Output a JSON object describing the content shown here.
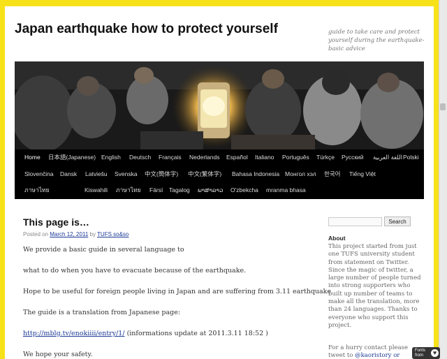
{
  "site": {
    "title": "Japan earthquake how to protect yourself",
    "tagline": "guide to take care and protect yourself during the earthquake- basic advice"
  },
  "nav": {
    "rows": [
      [
        "Home",
        "日本語(Japanese)",
        "English",
        "Deutsch",
        "Français",
        "Nederlands",
        "Español",
        "Italiano",
        "Português",
        "Türkçe",
        "Русский",
        "اللغة العربية",
        "Polski"
      ],
      [
        "Slovenčina",
        "Dansk",
        "Latviešu",
        "Svenska",
        "中文(簡体字)",
        "中文(繁体字)",
        "Bahasa Indonesia",
        "Монгол хэл",
        "한국어",
        "Tiếng Việt"
      ],
      [
        "ภาษาไทย",
        "Kiswahili",
        "ภาษาไทย",
        "Fārsī",
        "Tagalog",
        "ພາສາລາວ",
        "O'zbekcha",
        "mranma bhasa"
      ]
    ],
    "current": "Home"
  },
  "post": {
    "title": "This page is…",
    "meta_posted_on": "Posted on",
    "meta_date": "March 12, 2011",
    "meta_by": "by",
    "meta_author": "TUFS so&so",
    "paragraphs": [
      "We provide a basic guide in several language to",
      "what to do when you have to evacuate because of the earthquake.",
      "Hope to be useful for foreign people living in Japan and are suffering from 3.11 earthquake",
      "The guide is a translation from Japanese page:"
    ],
    "link_url": "http://mblg.tv/enokiiii/entry/1/",
    "link_suffix": " (informations update at 2011.3.11  18:52 )",
    "closing": "We hope your safety."
  },
  "sidebar": {
    "search_placeholder": "",
    "search_button": "Search",
    "about_title": "About",
    "about_text": "This project started from just one TUFS university student from statement on Twitter. Since the magic of twitter, a large number of people turned into strong supporters who built up number of teams to make all the translation, more than 24 languages. Thanks to everyone who support this project.",
    "contact_text_prefix": "For a hurry contact please tweet to ",
    "contact_handles": "@kaoristory or @oboo"
  },
  "badge": {
    "label": "Fonts from",
    "icon": "fonts-icon"
  },
  "colors": {
    "frame": "#f7e21a",
    "nav_bg": "#000000",
    "link": "#1b3a96"
  }
}
